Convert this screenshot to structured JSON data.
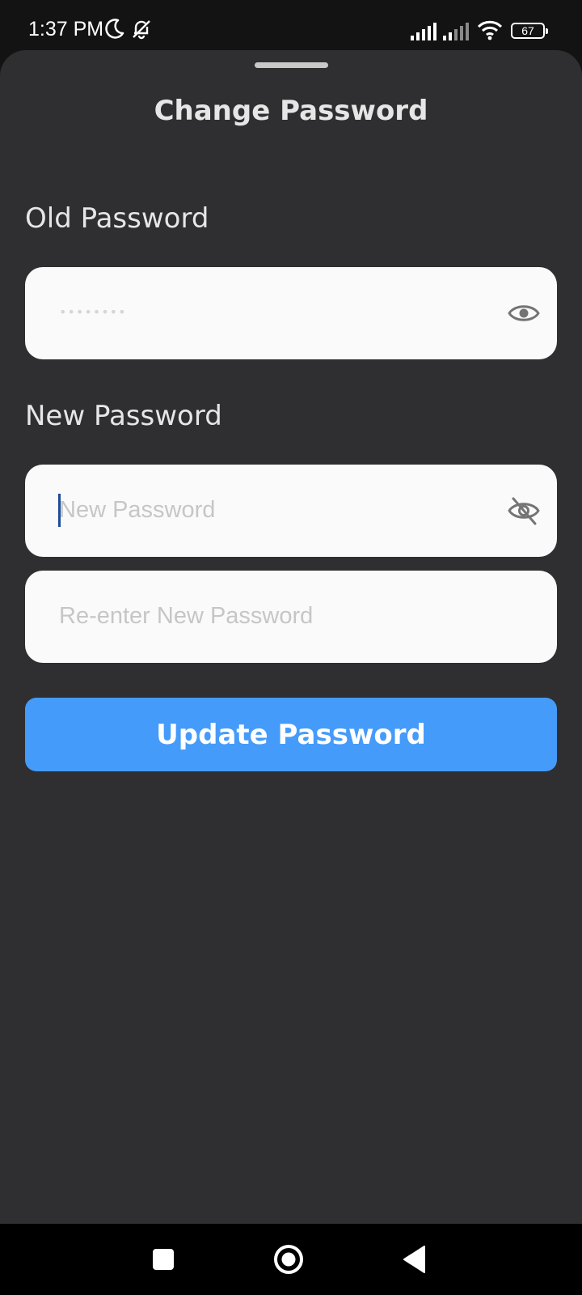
{
  "status_bar": {
    "time": "1:37 PM",
    "battery": "67",
    "icons": [
      "moon-icon",
      "bell-off-icon",
      "signal-icon",
      "signal-icon",
      "wifi-icon",
      "battery-icon"
    ]
  },
  "sheet": {
    "title": "Change Password",
    "old_password": {
      "label": "Old Password",
      "value": "••••••••",
      "icon": "eye-icon"
    },
    "new_password": {
      "label": "New Password",
      "placeholder": "New Password",
      "icon": "eye-off-icon"
    },
    "confirm_password": {
      "placeholder": "Re-enter New Password"
    },
    "submit_label": "Update Password"
  },
  "colors": {
    "sheet_background": "#2f2f31",
    "field_background": "#fafafa",
    "accent": "#459bfa",
    "caret": "#1e4b9a"
  },
  "nav_bar": {
    "icons": [
      "recents-square-icon",
      "home-circle-icon",
      "back-triangle-icon"
    ]
  }
}
